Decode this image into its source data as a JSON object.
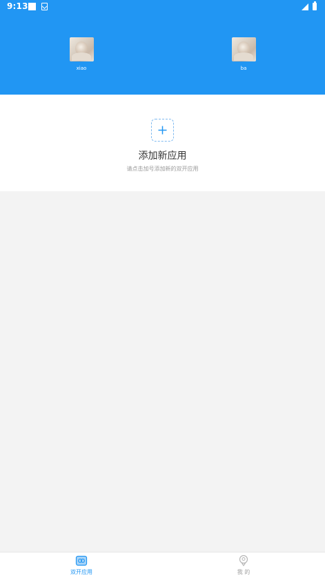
{
  "status": {
    "time": "9:13",
    "icons": [
      "square-notification-icon",
      "app-notification-icon",
      "signal-icon",
      "battery-icon"
    ]
  },
  "clones": [
    {
      "name": "xiao",
      "icon": "avatar-photo"
    },
    {
      "name": "ba",
      "icon": "avatar-photo"
    }
  ],
  "add": {
    "title": "添加新应用",
    "subtitle": "请点击加号添加新的双开应用",
    "icon": "plus-icon"
  },
  "nav": {
    "items": [
      {
        "label": "双开应用",
        "icon": "dual-app-icon",
        "active": true
      },
      {
        "label": "我 的",
        "icon": "profile-icon",
        "active": false
      }
    ]
  },
  "colors": {
    "primary": "#2196f3",
    "background": "#f3f3f3",
    "card": "#ffffff",
    "inactive": "#9e9e9e"
  }
}
